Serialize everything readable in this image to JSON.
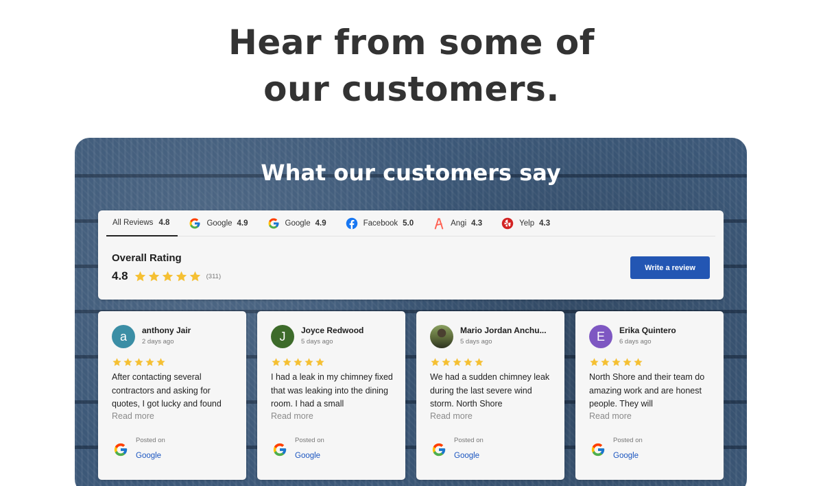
{
  "headline": [
    "Hear from some of",
    "our customers."
  ],
  "widget": {
    "title": "What our customers say",
    "tabs": [
      {
        "label": "All Reviews",
        "score": "4.8",
        "icon": "none"
      },
      {
        "label": "Google",
        "score": "4.9",
        "icon": "google-icon"
      },
      {
        "label": "Google",
        "score": "4.9",
        "icon": "google-icon"
      },
      {
        "label": "Facebook",
        "score": "5.0",
        "icon": "facebook-icon"
      },
      {
        "label": "Angi",
        "score": "4.3",
        "icon": "angi-icon"
      },
      {
        "label": "Yelp",
        "score": "4.3",
        "icon": "yelp-icon"
      }
    ],
    "overall": {
      "label": "Overall Rating",
      "score": "4.8",
      "stars": 5,
      "count": "(311)"
    },
    "write_review_label": "Write a review",
    "reviews": [
      {
        "name": "anthony Jair",
        "date": "2 days ago",
        "avatar_letter": "a",
        "avatar_color": "#3b8ea5",
        "stars": 5,
        "text": "After contacting several contractors and asking for quotes, I got lucky and found",
        "read_more": "Read more",
        "posted_on": "Posted on",
        "source": "Google"
      },
      {
        "name": "Joyce Redwood",
        "date": "5 days ago",
        "avatar_letter": "J",
        "avatar_color": "#3d6b2a",
        "stars": 5,
        "text": "I had a leak in my chimney fixed that was leaking into the dining room. I had a small",
        "read_more": "Read more",
        "posted_on": "Posted on",
        "source": "Google"
      },
      {
        "name": "Mario Jordan Anchu...",
        "date": "5 days ago",
        "avatar_letter": "",
        "avatar_color": "photo",
        "stars": 5,
        "text": "We had a sudden chimney leak during the last severe wind storm. North Shore",
        "read_more": "Read more",
        "posted_on": "Posted on",
        "source": "Google"
      },
      {
        "name": "Erika Quintero",
        "date": "6 days ago",
        "avatar_letter": "E",
        "avatar_color": "#7e57c2",
        "stars": 5,
        "text": "North Shore and their team do amazing work and are honest people. They will",
        "read_more": "Read more",
        "posted_on": "Posted on",
        "source": "Google"
      }
    ]
  },
  "colors": {
    "star": "#f5c033",
    "button": "#2356b3",
    "link": "#1a55c0",
    "background": "#3c5878"
  }
}
